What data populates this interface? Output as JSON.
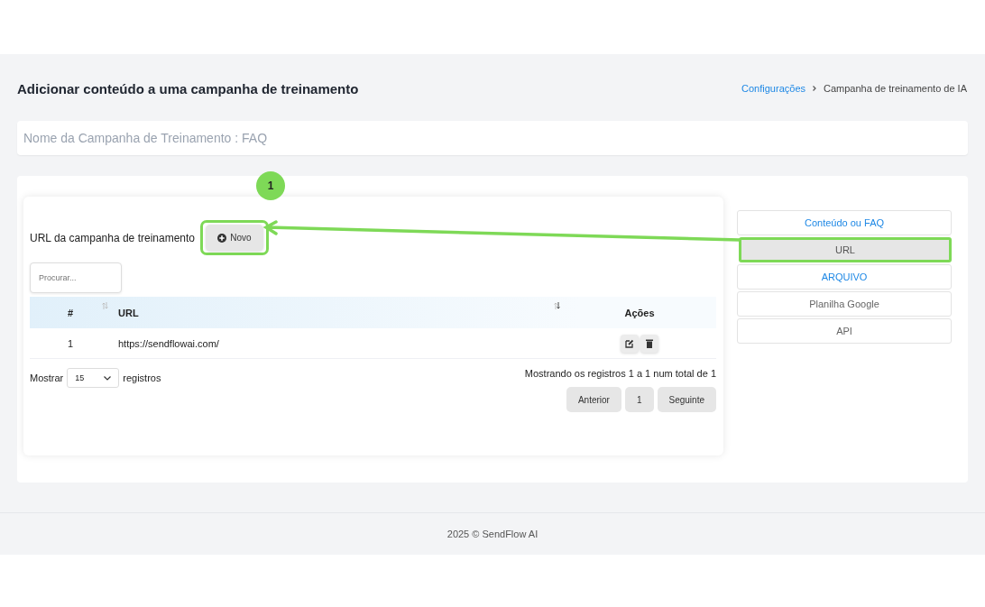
{
  "header": {
    "title": "Adicionar conteúdo a uma campanha de treinamento",
    "breadcrumb": {
      "link": "Configurações",
      "current": "Campanha de treinamento de IA"
    }
  },
  "campaign_name": {
    "value": "Nome da Campanha de Treinamento : FAQ"
  },
  "panel": {
    "title": "URL da campanha de treinamento",
    "new_button": "Novo",
    "search": {
      "placeholder": "Procurar..."
    },
    "table": {
      "columns": [
        "#",
        "URL",
        "Ações"
      ],
      "rows": [
        {
          "index": "1",
          "url": "https://sendflowai.com/"
        }
      ]
    },
    "page_size": {
      "label_before": "Mostrar",
      "value": "15",
      "label_after": "registros"
    },
    "info": "Mostrando os registros 1 a 1 num total de 1",
    "pagination": [
      {
        "label": "Anterior",
        "selected": false
      },
      {
        "label": "1",
        "selected": false
      },
      {
        "label": "Seguinte",
        "selected": false
      }
    ]
  },
  "side_menu": [
    {
      "label": "Conteúdo ou FAQ",
      "kind": "link",
      "selected": false
    },
    {
      "label": "URL",
      "kind": "plain",
      "selected": true
    },
    {
      "label": "ARQUIVO",
      "kind": "link",
      "selected": false
    },
    {
      "label": "Planilha Google",
      "kind": "plain",
      "selected": false
    },
    {
      "label": "API",
      "kind": "plain",
      "selected": false
    }
  ],
  "annotation": {
    "badge": "1"
  },
  "footer": "2025 © SendFlow AI"
}
